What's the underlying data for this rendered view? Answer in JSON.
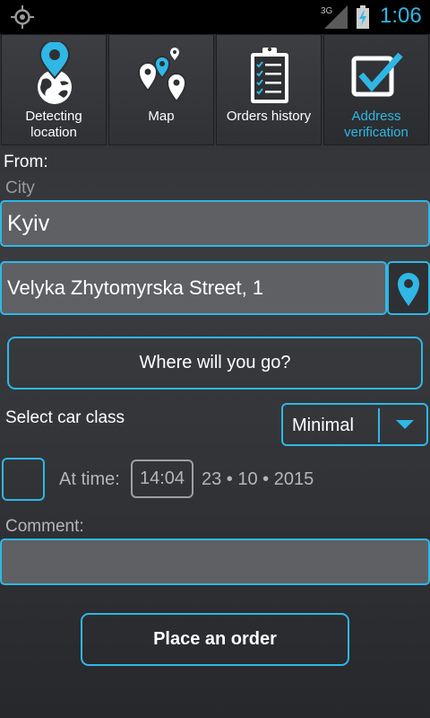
{
  "status_bar": {
    "time": "1:06",
    "network": "3G",
    "icons": [
      "gps-icon",
      "signal-icon",
      "battery-charging-icon"
    ]
  },
  "tabs": [
    {
      "label": "Detecting location",
      "icon": "globe-pin-icon",
      "active": false
    },
    {
      "label": "Map",
      "icon": "map-pins-icon",
      "active": false
    },
    {
      "label": "Orders history",
      "icon": "clipboard-list-icon",
      "active": false
    },
    {
      "label": "Address verification",
      "icon": "checkbox-check-icon",
      "active": true
    }
  ],
  "form": {
    "from_label": "From:",
    "city_placeholder": "City",
    "city_value": "Kyiv",
    "street_value": "Velyka Zhytomyrska Street, 1",
    "destination_button": "Where will you go?",
    "car_class_label": "Select car class",
    "car_class_value": "Minimal",
    "at_time_label": "At time:",
    "time_value": "14:04",
    "date_value": "23 • 10 • 2015",
    "comment_label": "Comment:",
    "comment_value": "",
    "submit_button": "Place an order"
  },
  "colors": {
    "accent": "#2fb7e6",
    "field_bg": "#5f6064",
    "background": "#3a3c40",
    "status_bar": "#000000"
  }
}
